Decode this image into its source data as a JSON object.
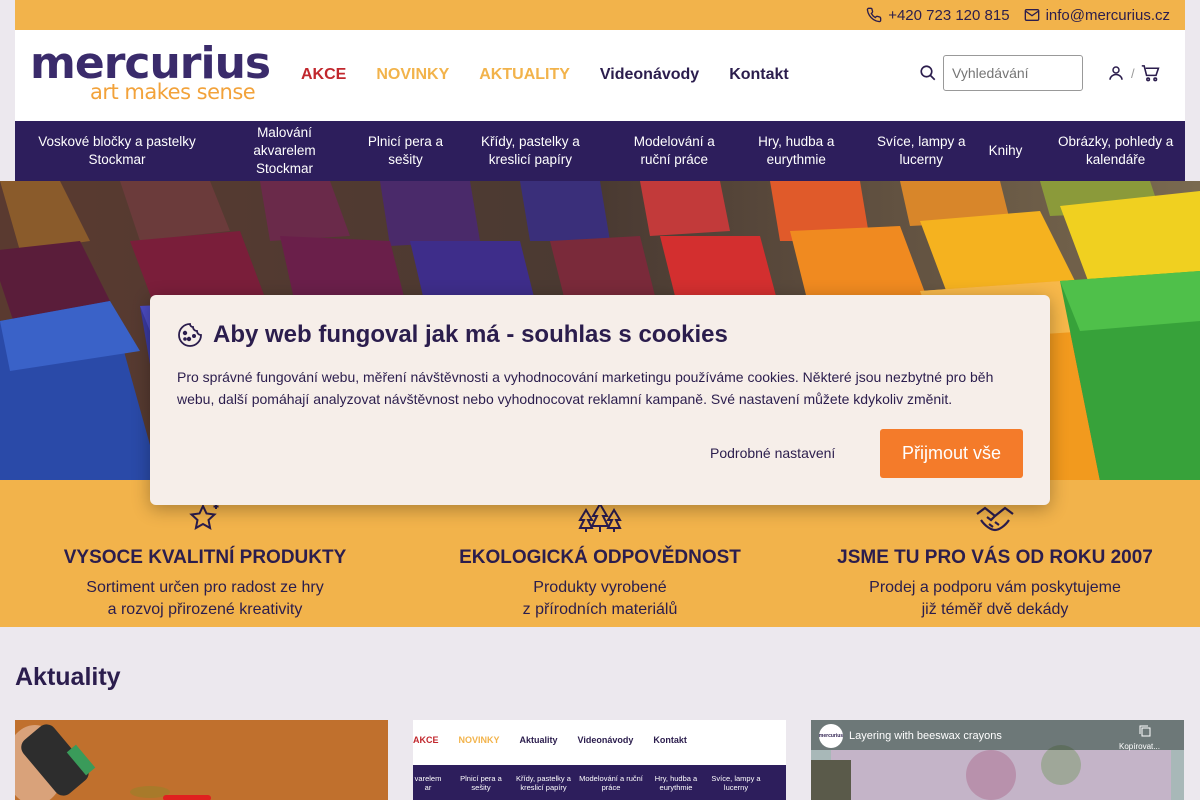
{
  "topbar": {
    "phone": "+420 723 120 815",
    "email": "info@mercurius.cz"
  },
  "logo": {
    "line1": "mercurius",
    "line2": "art makes sense"
  },
  "nav": [
    "AKCE",
    "NOVINKY",
    "AKTUALITY",
    "Videonávody",
    "Kontakt"
  ],
  "search": {
    "placeholder": "Vyhledávání"
  },
  "user": {
    "separator": "/"
  },
  "categories": [
    "Voskové bločky a pastelky Stockmar",
    "Malování akvarelem Stockmar",
    "Plnicí pera a sešity",
    "Křídy, pastelky a kreslicí papíry",
    "Modelování a ruční práce",
    "Hry, hudba a eurythmie",
    "Svíce, lampy a lucerny",
    "Knihy",
    "Obrázky, pohledy a kalendáře"
  ],
  "features": [
    {
      "title": "VYSOCE KVALITNÍ PRODUKTY",
      "line1": "Sortiment určen pro radost ze hry",
      "line2": "a rozvoj přirozené kreativity"
    },
    {
      "title": "EKOLOGICKÁ ODPOVĚDNOST",
      "line1": "Produkty vyrobené",
      "line2": "z přírodních materiálů"
    },
    {
      "title": "JSME TU PRO VÁS OD ROKU 2007",
      "line1": "Prodej a podporu vám poskytujeme",
      "line2": "již téměř dvě dekády"
    }
  ],
  "news": {
    "title": "Aktuality"
  },
  "cards": {
    "card2_nav": [
      "AKCE",
      "NOVINKY",
      "Aktuality",
      "Videonávody",
      "Kontakt"
    ],
    "card2_cats": [
      "varelem ar",
      "Plnicí pera a sešity",
      "Křídy, pastelky a kreslicí papíry",
      "Modelování a ruční práce",
      "Hry, hudba a eurythmie",
      "Svíce, lampy a lucerny"
    ],
    "card3_title": "Layering with beeswax crayons",
    "card3_copy": "Kopírovat...",
    "card3_channel": "mercurius"
  },
  "cookie": {
    "title": "Aby web fungoval jak má - souhlas s cookies",
    "text": "Pro správné fungování webu, měření návštěvnosti a vyhodnocování marketingu používáme cookies. Některé jsou nezbytné pro běh webu, další pomáhají analyzovat návštěvnost nebo vyhodnocovat reklamní kampaně. Své nastavení můžete kdykoliv změnit.",
    "settings": "Podrobné nastavení",
    "accept": "Přijmout vše"
  },
  "colors": {
    "primary": "#2d1e5c",
    "accent": "#f2b34b",
    "cta": "#f47b2a",
    "sale": "#c1272d"
  }
}
